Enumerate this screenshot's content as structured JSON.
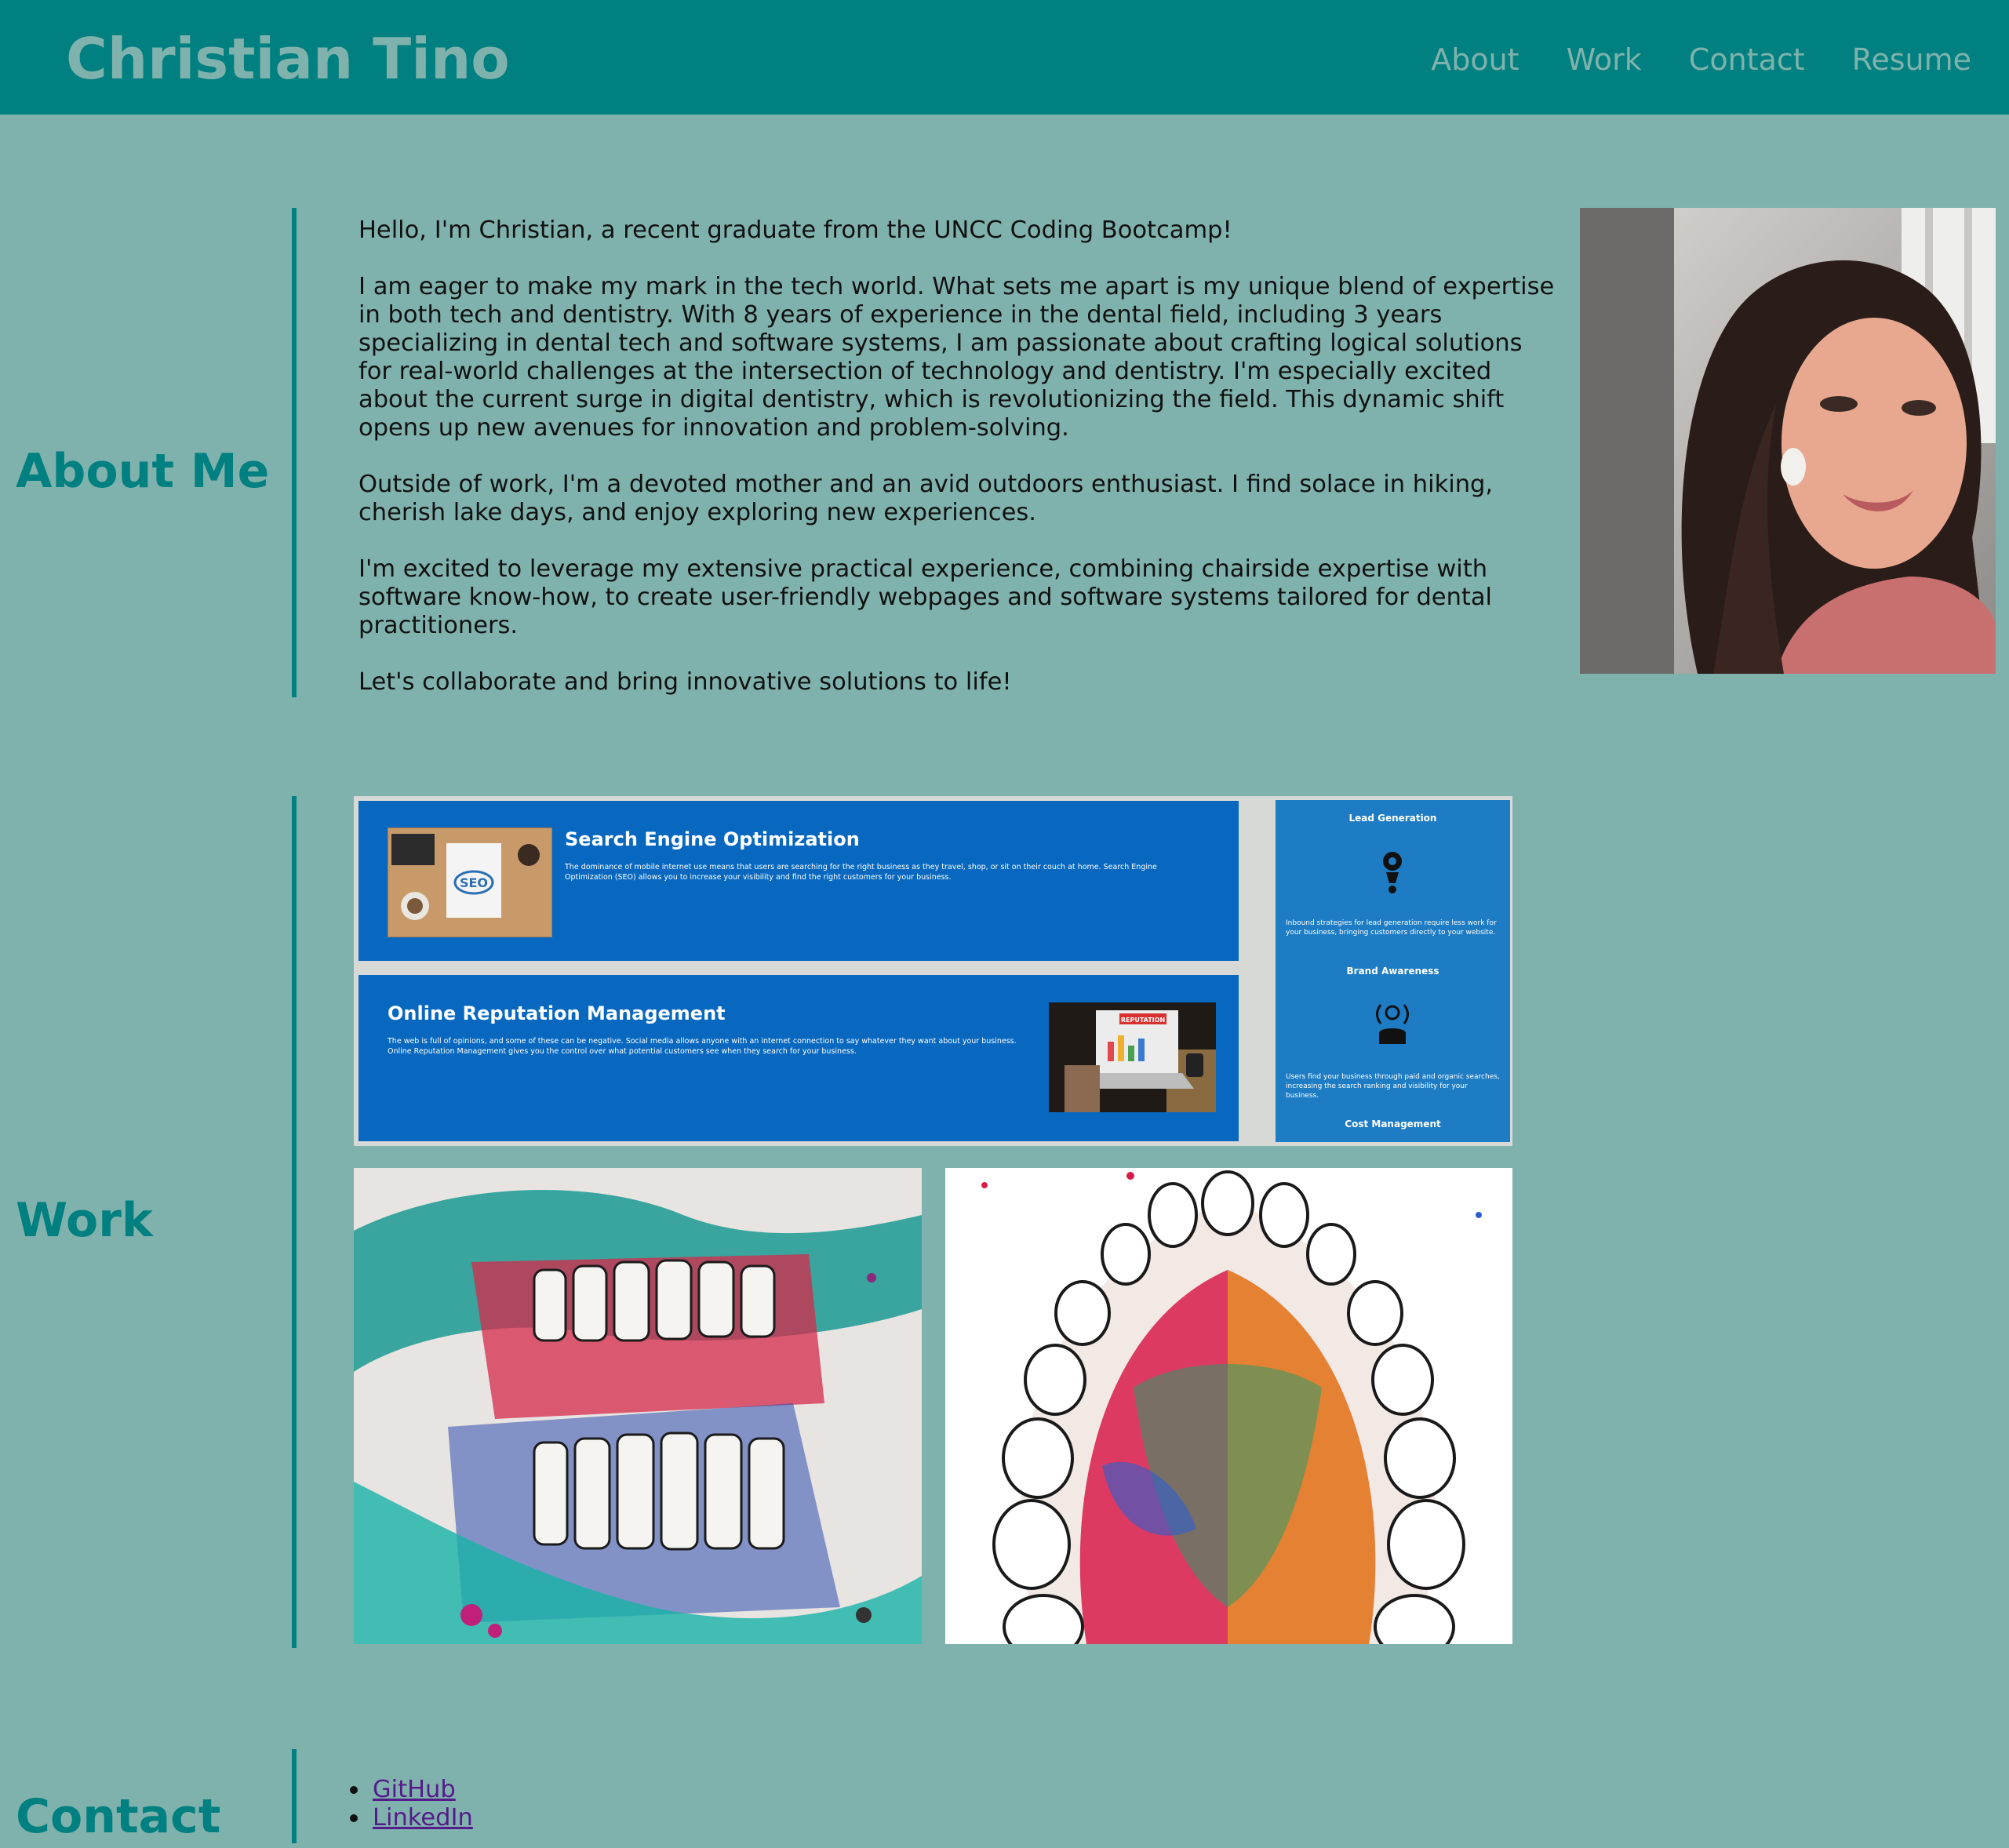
{
  "header": {
    "title": "Christian Tino",
    "nav": [
      "About",
      "Work",
      "Contact",
      "Resume"
    ]
  },
  "about": {
    "heading": "About Me",
    "paragraphs": [
      "Hello, I'm Christian, a recent graduate from the UNCC Coding Bootcamp!",
      "I am eager to make my mark in the tech world. What sets me apart is my unique blend of expertise in both tech and dentistry. With 8 years of experience in the dental field, including 3 years specializing in dental tech and software systems, I am passionate about crafting logical solutions for real-world challenges at the intersection of technology and dentistry. I'm especially excited about the current surge in digital dentistry, which is revolutionizing the field. This dynamic shift opens up new avenues for innovation and problem-solving.",
      "Outside of work, I'm a devoted mother and an avid outdoors enthusiast. I find solace in hiking, cherish lake days, and enjoy exploring new experiences.",
      "I'm excited to leverage my extensive practical experience, combining chairside expertise with software know-how, to create user-friendly webpages and software systems tailored for dental practitioners.",
      "Let's collaborate and bring innovative solutions to life!"
    ]
  },
  "work": {
    "heading": "Work",
    "project1": {
      "seo_title": "Search Engine Optimization",
      "seo_desc": "The dominance of mobile internet use means that users are searching for the right business as they travel, shop, or sit on their couch at home. Search Engine Optimization (SEO) allows you to increase your visibility and find the right customers for your business.",
      "orm_title": "Online Reputation Management",
      "orm_desc": "The web is full of opinions, and some of these can be negative. Social media allows anyone with an internet connection to say whatever they want about your business. Online Reputation Management gives you the control over what potential customers see when they search for your business.",
      "side": {
        "lead_title": "Lead Generation",
        "lead_text": "Inbound strategies for lead generation require less work for your business, bringing customers directly to your website.",
        "brand_title": "Brand Awareness",
        "brand_text": "Users find your business through paid and organic searches, increasing the search ranking and visibility for your business.",
        "cost_title": "Cost Management"
      },
      "seo_badge": "SEO",
      "reputation_badge": "REPUTATION"
    }
  },
  "contact": {
    "heading": "Contact",
    "links": [
      "GitHub",
      "LinkedIn"
    ]
  },
  "colors": {
    "header_bg": "#008080",
    "page_bg": "#80b2ad",
    "accent": "#008080",
    "card_blue": "#0868c0"
  }
}
